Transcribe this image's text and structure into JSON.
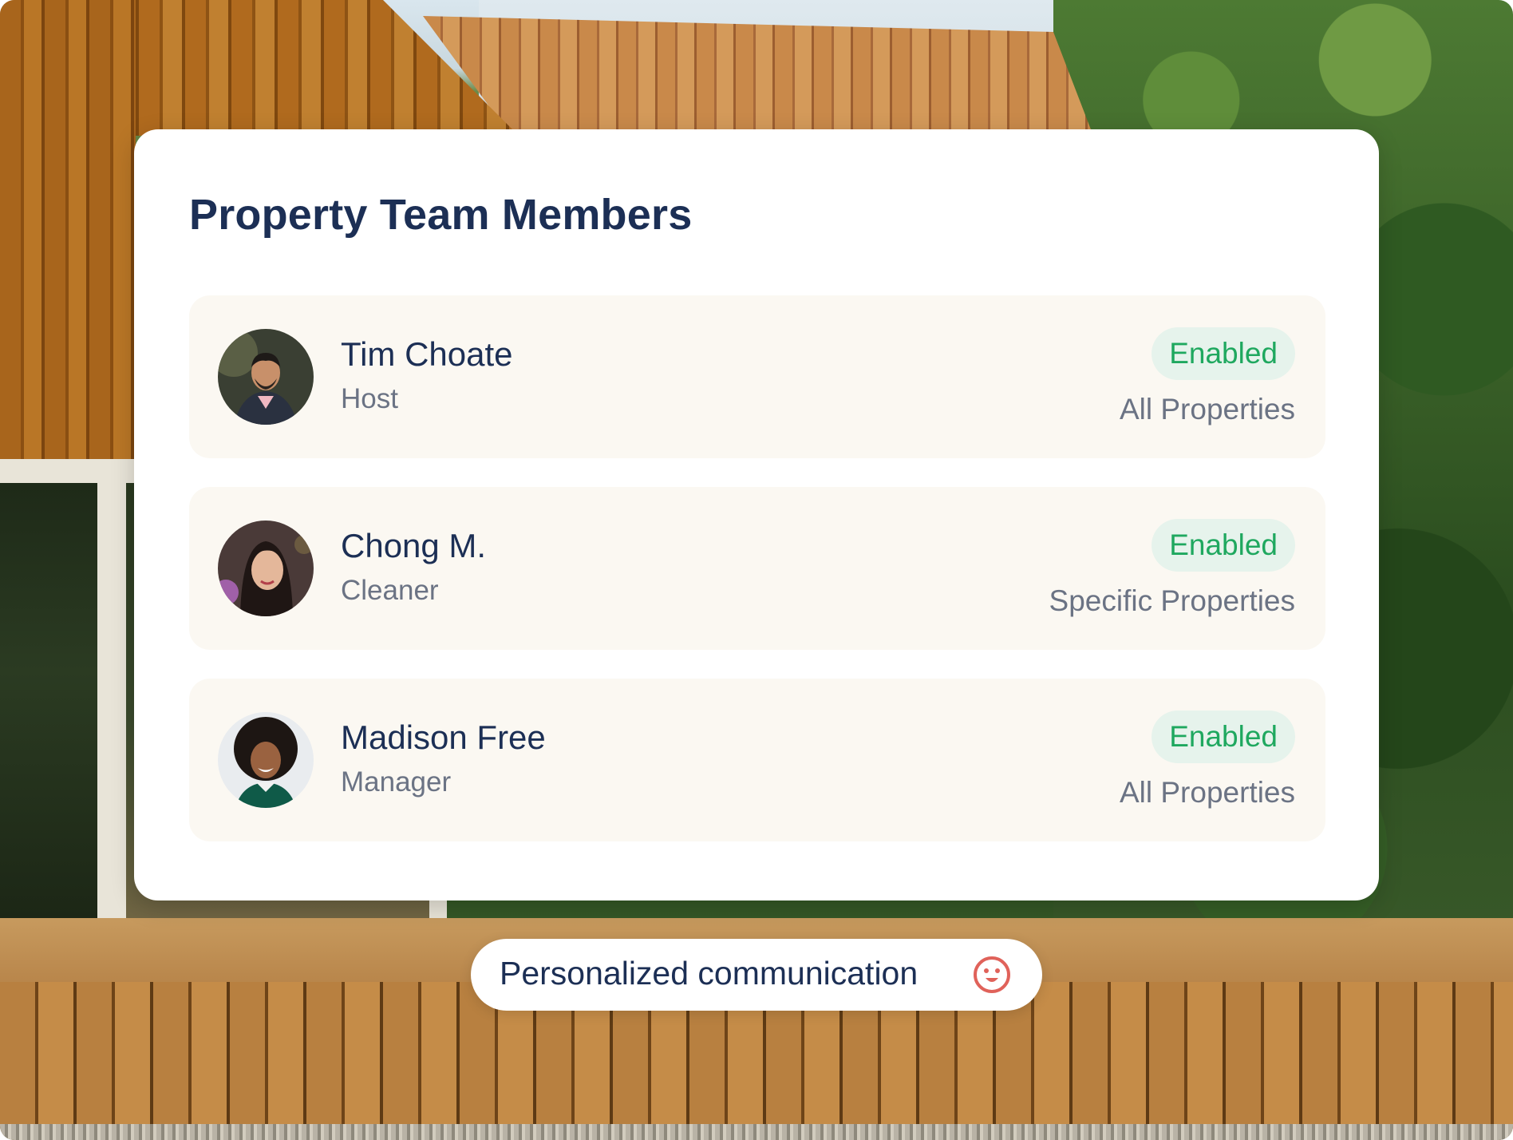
{
  "card": {
    "title": "Property Team Members"
  },
  "members": [
    {
      "name": "Tim Choate",
      "role": "Host",
      "status": "Enabled",
      "scope": "All Properties"
    },
    {
      "name": "Chong M.",
      "role": "Cleaner",
      "status": "Enabled",
      "scope": "Specific Properties"
    },
    {
      "name": "Madison Free",
      "role": "Manager",
      "status": "Enabled",
      "scope": "All Properties"
    }
  ],
  "pill": {
    "label": "Personalized communication",
    "icon": "smile-icon"
  },
  "colors": {
    "title": "#1c2f55",
    "muted": "#6b7384",
    "status_text": "#1fa85f",
    "status_bg": "#e6f3ec",
    "row_bg": "#fbf8f2",
    "icon_accent": "#e0625a"
  }
}
